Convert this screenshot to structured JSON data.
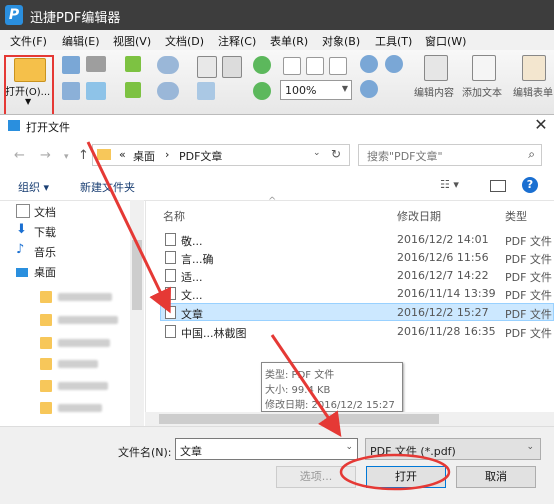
{
  "app": {
    "logo": "P",
    "title": "迅捷PDF编辑器"
  },
  "menu": [
    "文件(F)",
    "编辑(E)",
    "视图(V)",
    "文档(D)",
    "注释(C)",
    "表单(R)",
    "对象(B)",
    "工具(T)",
    "窗口(W)"
  ],
  "toolbar": {
    "open_label": "打开(O)...",
    "zoom_value": "100%",
    "edit_content_label": "编辑内容",
    "add_text_label": "添加文本",
    "edit_form_label": "编辑表单"
  },
  "dialog": {
    "title": "打开文件",
    "close": "✕",
    "breadcrumb": [
      "«",
      "桌面",
      "›",
      "PDF文章"
    ],
    "search_placeholder": "搜索\"PDF文章\"",
    "organize": "组织 ▾",
    "new_folder": "新建文件夹",
    "sidebar": [
      {
        "label": "文档",
        "icon": "document-icon"
      },
      {
        "label": "下载",
        "icon": "download-icon"
      },
      {
        "label": "音乐",
        "icon": "music-icon"
      },
      {
        "label": "桌面",
        "icon": "desktop-icon"
      }
    ],
    "columns": {
      "name": "名称",
      "date": "修改日期",
      "type": "类型"
    },
    "files": [
      {
        "name": "敬...",
        "date": "2016/12/2 14:01",
        "type": "PDF 文件"
      },
      {
        "name": "言...确",
        "date": "2016/12/6 11:56",
        "type": "PDF 文件"
      },
      {
        "name": "适...",
        "date": "2016/12/7 14:22",
        "type": "PDF 文件"
      },
      {
        "name": "文...",
        "date": "2016/11/14 13:39",
        "type": "PDF 文件"
      },
      {
        "name": "文章",
        "date": "2016/12/2 15:27",
        "type": "PDF 文件"
      },
      {
        "name": "中国...林截图",
        "date": "2016/11/28 16:35",
        "type": "PDF 文件"
      }
    ],
    "tooltip": [
      "类型: PDF 文件",
      "大小: 99.4 KB",
      "修改日期: 2016/12/2 15:27"
    ],
    "filename_label": "文件名(N):",
    "filename_value": "文章",
    "filter_value": "PDF 文件 (*.pdf)",
    "options_button": "选项...",
    "open_button": "打开",
    "cancel_button": "取消"
  },
  "colors": {
    "title_bar": "#3d3d3d",
    "highlight": "#e53935",
    "selection": "#cce8ff",
    "link_blue": "#1a5fb4"
  }
}
